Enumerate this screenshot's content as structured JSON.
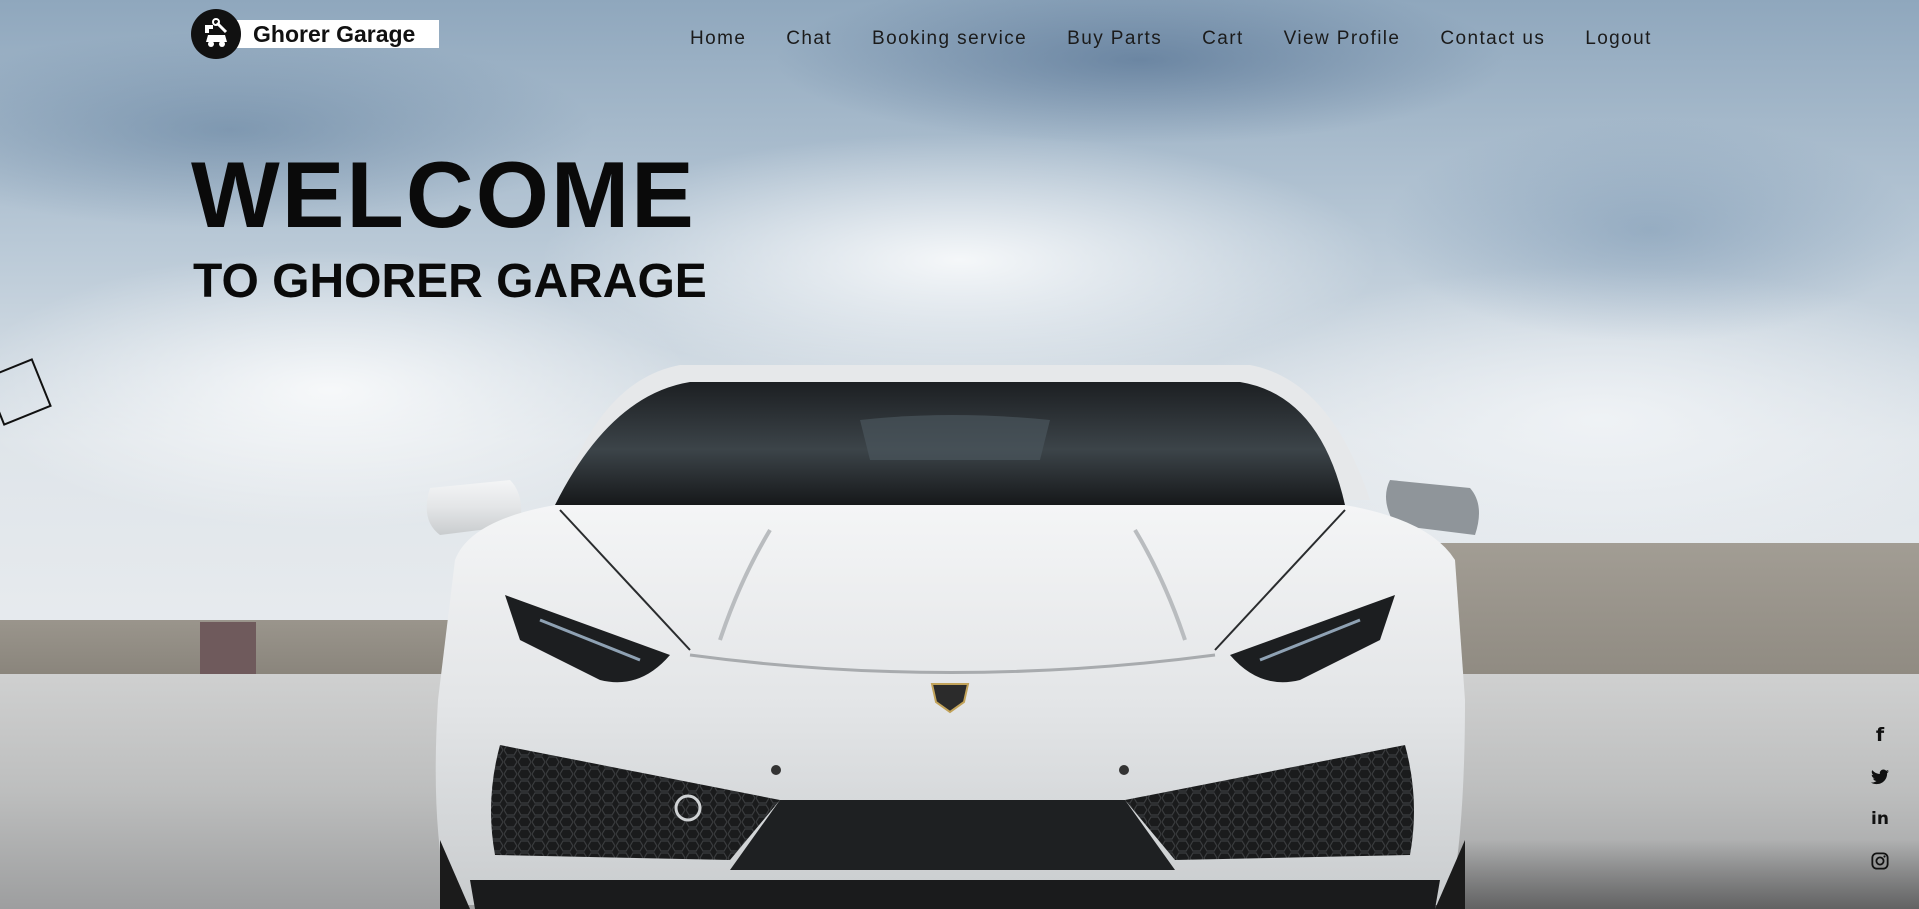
{
  "brand": {
    "name": "Ghorer Garage",
    "logo_icon": "wrench-car-logo-icon"
  },
  "nav": {
    "items": [
      {
        "label": "Home"
      },
      {
        "label": "Chat"
      },
      {
        "label": "Booking service"
      },
      {
        "label": "Buy Parts"
      },
      {
        "label": "Cart"
      },
      {
        "label": "View Profile"
      },
      {
        "label": "Contact us"
      },
      {
        "label": "Logout"
      }
    ]
  },
  "hero": {
    "title": "WELCOME",
    "subtitle": "TO GHORER GARAGE",
    "background": "white sports car under cloudy sky"
  },
  "social": {
    "icons": [
      "facebook-icon",
      "twitter-icon",
      "linkedin-icon",
      "instagram-icon"
    ],
    "facebook_glyph": "f",
    "linkedin_glyph": "in"
  },
  "colors": {
    "text": "#111111",
    "brand_bg": "#ffffff",
    "logo_bg": "#111111"
  }
}
